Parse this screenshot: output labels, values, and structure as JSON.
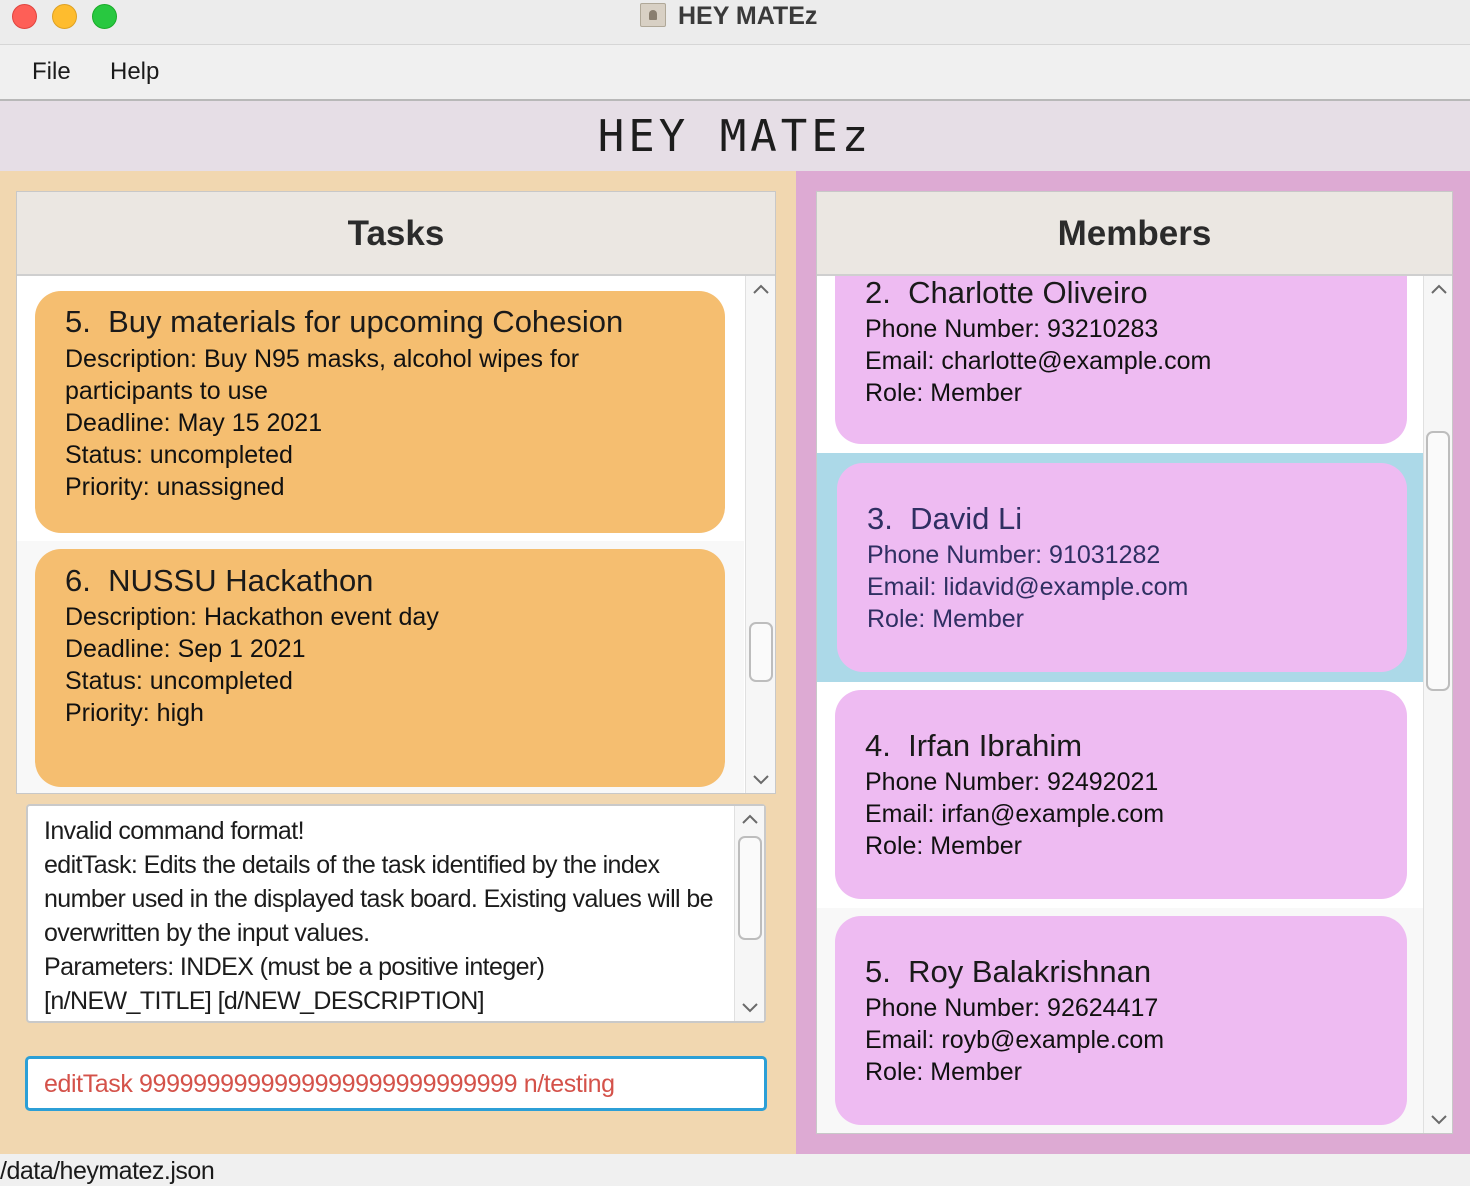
{
  "window": {
    "title": "HEY MATEz"
  },
  "menu": {
    "file": "File",
    "help": "Help"
  },
  "header": {
    "title": "HEY MATEz"
  },
  "tasks": {
    "title": "Tasks",
    "items": [
      {
        "index": "5.",
        "name": "Buy materials for upcoming Cohesion",
        "description_1": "Description: Buy N95 masks, alcohol wipes for",
        "description_2": "participants to use",
        "deadline": "Deadline: May 15 2021",
        "status": "Status: uncompleted",
        "priority": "Priority: unassigned"
      },
      {
        "index": "6.",
        "name": "NUSSU Hackathon",
        "description": "Description: Hackathon event day",
        "deadline": "Deadline: Sep 1 2021",
        "status": "Status: uncompleted",
        "priority": "Priority: high"
      }
    ]
  },
  "result": {
    "text": "Invalid command format!\neditTask: Edits the details of the task identified by the index number used in the displayed task board. Existing values will be overwritten by the input values.\nParameters: INDEX (must be a positive integer)\n[n/NEW_TITLE] [d/NEW_DESCRIPTION]"
  },
  "command": {
    "value": "editTask 9999999999999999999999999999 n/testing"
  },
  "members": {
    "title": "Members",
    "items": [
      {
        "index": "2.",
        "name": "Charlotte Oliveiro",
        "phone": "Phone Number: 93210283",
        "email": "Email: charlotte@example.com",
        "role": "Role: Member"
      },
      {
        "index": "3.",
        "name": "David Li",
        "phone": "Phone Number: 91031282",
        "email": "Email: lidavid@example.com",
        "role": "Role: Member"
      },
      {
        "index": "4.",
        "name": "Irfan Ibrahim",
        "phone": "Phone Number: 92492021",
        "email": "Email: irfan@example.com",
        "role": "Role: Member"
      },
      {
        "index": "5.",
        "name": "Roy Balakrishnan",
        "phone": "Phone Number: 92624417",
        "email": "Email: royb@example.com",
        "role": "Role: Member"
      }
    ]
  },
  "status_bar": {
    "path": "/data/heymatez.json"
  },
  "colors": {
    "task_card": "#f5be70",
    "member_card": "#eebbf2",
    "selected_row": "#acd9e8",
    "left_background": "#f1d7b0",
    "right_background": "#ddaad3",
    "command_text": "#d4524a",
    "command_border": "#2c9fd6"
  }
}
